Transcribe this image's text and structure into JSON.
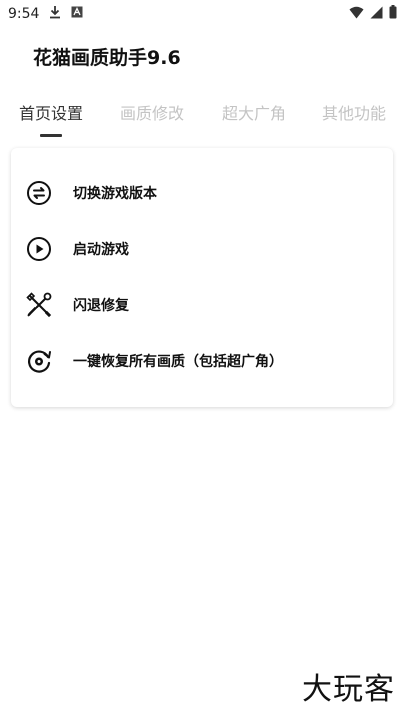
{
  "status_bar": {
    "time": "9:54",
    "download_icon": "download-icon",
    "notification_icon": "app-notification-icon",
    "wifi_icon": "wifi-icon",
    "signal_icon": "signal-icon",
    "battery_icon": "battery-icon"
  },
  "app": {
    "title": "花猫画质助手9.6"
  },
  "tabs": [
    {
      "label": "首页设置",
      "active": true
    },
    {
      "label": "画质修改",
      "active": false
    },
    {
      "label": "超大广角",
      "active": false
    },
    {
      "label": "其他功能",
      "active": false
    }
  ],
  "menu": [
    {
      "label": "切换游戏版本",
      "icon": "swap-icon"
    },
    {
      "label": "启动游戏",
      "icon": "play-icon"
    },
    {
      "label": "闪退修复",
      "icon": "tools-icon"
    },
    {
      "label": "一键恢复所有画质（包括超广角）",
      "icon": "restore-icon"
    }
  ],
  "watermark": "大玩客",
  "colors": {
    "tab_active": "#333333",
    "tab_inactive": "#c4c4c4",
    "text": "#111111"
  }
}
